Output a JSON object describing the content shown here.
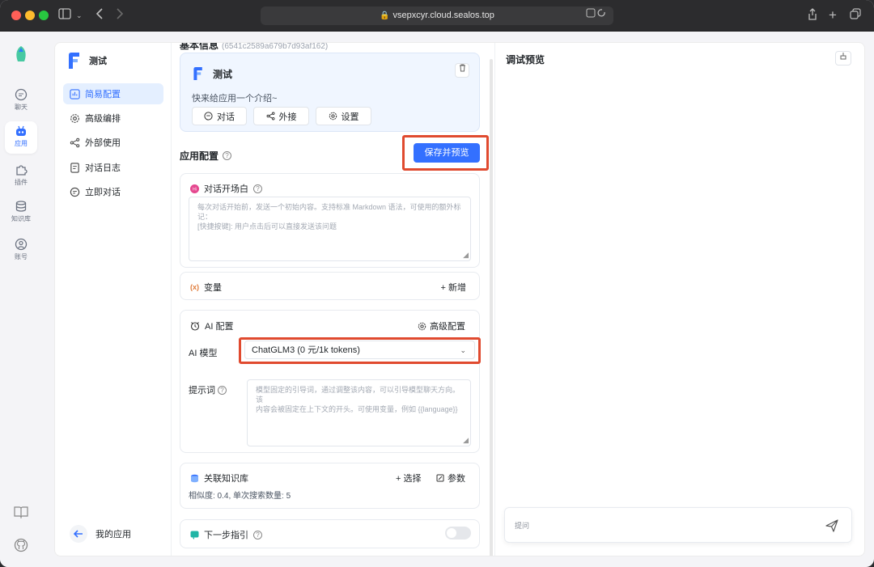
{
  "browser": {
    "url": "vsepxcyr.cloud.sealos.top"
  },
  "nav": {
    "items": [
      {
        "label": "聊天"
      },
      {
        "label": "应用"
      },
      {
        "label": "插件"
      },
      {
        "label": "知识库"
      },
      {
        "label": "账号"
      }
    ]
  },
  "app": {
    "name": "测试",
    "menu": [
      {
        "label": "简易配置"
      },
      {
        "label": "高级编排"
      },
      {
        "label": "外部使用"
      },
      {
        "label": "对话日志"
      },
      {
        "label": "立即对话"
      }
    ],
    "back_label": "我的应用"
  },
  "basic_info": {
    "title": "基本信息",
    "id_text": "(6541c2589a679b7d93af162)",
    "app_name": "测试",
    "intro": "快来给应用一个介绍~",
    "buttons": [
      "对话",
      "外接",
      "设置"
    ]
  },
  "config": {
    "title": "应用配置",
    "save_label": "保存并预览",
    "opening": {
      "title": "对话开场白",
      "placeholder_line1": "每次对话开始前，发送一个初始内容。支持标准 Markdown 语法，可使用的额外标",
      "placeholder_line2": "记：",
      "placeholder_line3": "[快捷按键]: 用户点击后可以直接发送该问题"
    },
    "variables": {
      "title": "变量",
      "add_label": "+ 新增"
    },
    "ai": {
      "title": "AI 配置",
      "advanced_label": "高级配置",
      "model_label": "AI 模型",
      "model_value": "ChatGLM3 (0 元/1k tokens)",
      "prompt_label": "提示词",
      "prompt_placeholder_line1": "模型固定的引导词，通过调整该内容，可以引导模型聊天方向。该",
      "prompt_placeholder_line2": "内容会被固定在上下文的开头。可使用变量，例如 {{language}}"
    },
    "kb": {
      "title": "关联知识库",
      "select_label": "+ 选择",
      "params_label": "参数",
      "summary": "相似度: 0.4, 单次搜索数量: 5"
    },
    "next_guide": {
      "title": "下一步指引"
    }
  },
  "preview": {
    "title": "调试预览",
    "input_placeholder": "提问"
  },
  "colors": {
    "accent": "#3370ff",
    "highlight": "#e04a2f"
  }
}
